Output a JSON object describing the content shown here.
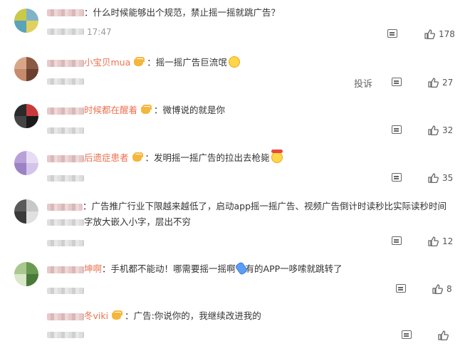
{
  "comments": [
    {
      "name": "",
      "text": "：什么时候能够出个规范，禁止摇一摇就跳广告？",
      "time": "17:47",
      "likes": "178",
      "avatar_colors": [
        "#c9c94a",
        "#7fb3c9",
        "#5aa3b8",
        "#e0d060"
      ]
    },
    {
      "name": "小宝贝mua",
      "text": "：摇一摇广告巨流氓",
      "report": "投诉",
      "likes": "27",
      "avatar_colors": [
        "#d9a688",
        "#8a5a44",
        "#c48b6c",
        "#6b4030"
      ]
    },
    {
      "name": "时候都在醒着",
      "text": "：微博说的就是你",
      "likes": "32",
      "avatar_colors": [
        "#2a2a2a",
        "#c93a3a",
        "#444444",
        "#1a1a1a"
      ]
    },
    {
      "name": "后遗症患者",
      "text": "：发明摇一摇广告的拉出去枪毙",
      "likes": "35",
      "avatar_colors": [
        "#b8a0d8",
        "#e8dcf4",
        "#9c82c4",
        "#d4c4ea"
      ]
    },
    {
      "name": "",
      "text": "：广告推广行业下限越来越低了，启动app摇一摇广告、视频广告倒计时读秒比实际读秒时间",
      "text2": "字放大嵌入小字，层出不穷",
      "likes": "12",
      "avatar_colors": [
        "#5a5a5a",
        "#c8c8c8",
        "#3a3a3a",
        "#e0e0e0"
      ]
    },
    {
      "name": "坤啊",
      "text": "：手机都不能动！哪需要摇一摇啊",
      "text_after": "有的APP一哆嗦就跳转了",
      "likes": "8",
      "avatar_colors": [
        "#a8c890",
        "#6a9a50",
        "#d8e8c8",
        "#4a7a3a"
      ]
    },
    {
      "name": "冬viki",
      "text": "：广告:你说你的，我继续改进我的",
      "likes": "",
      "avatar_colors": []
    }
  ]
}
